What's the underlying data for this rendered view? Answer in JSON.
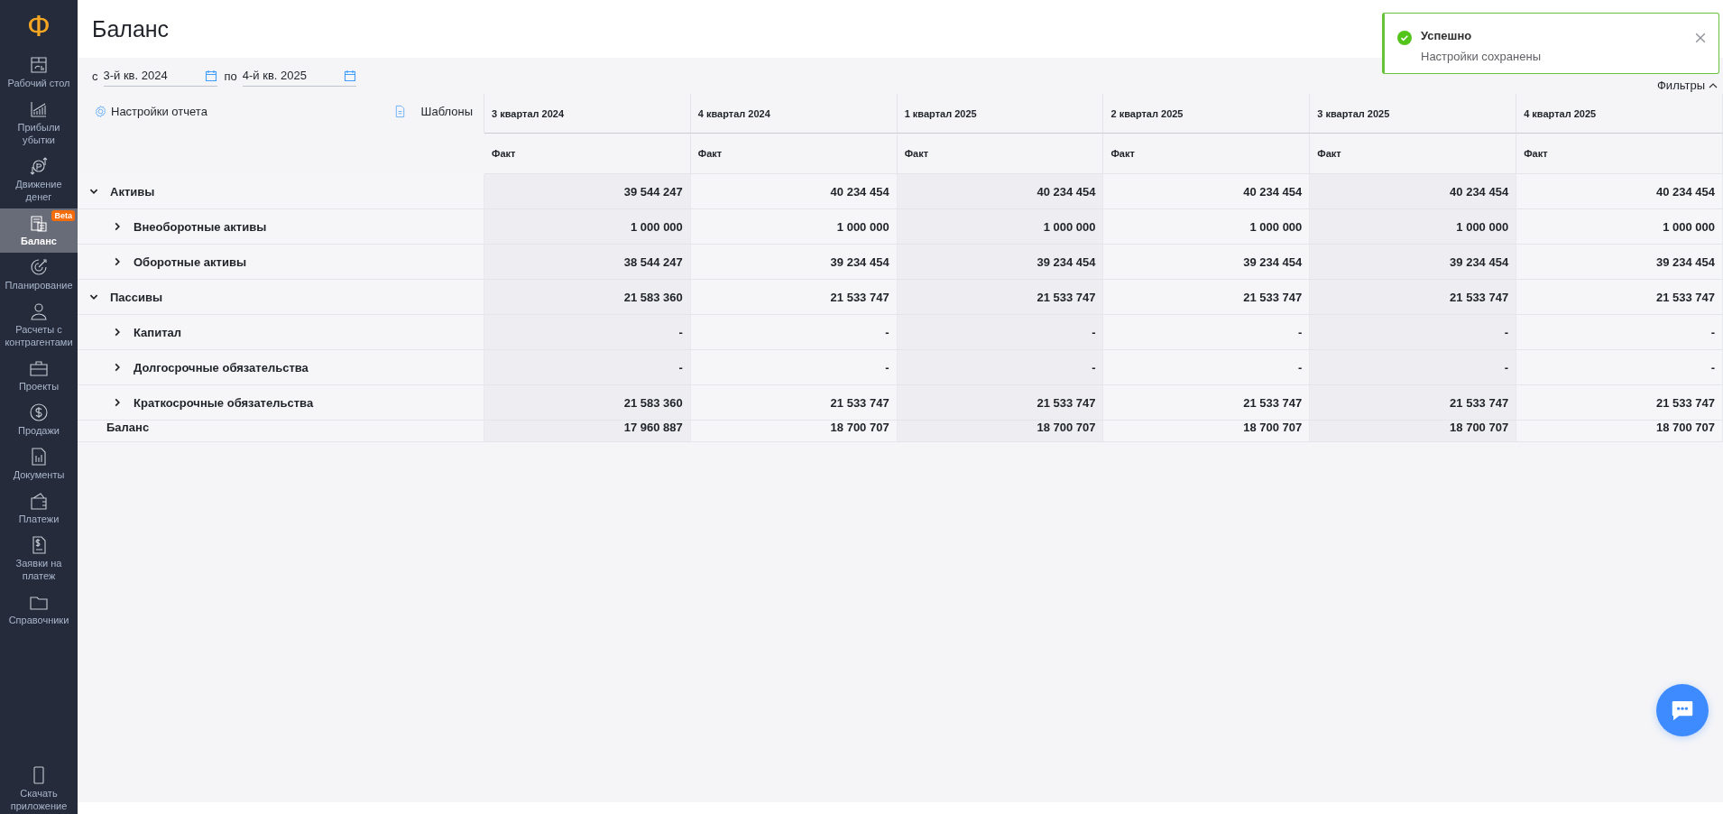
{
  "sidebar": {
    "logo": "Ф",
    "items": [
      {
        "label": "Рабочий стол",
        "selected": false
      },
      {
        "label": "Прибыли\nубытки",
        "selected": false
      },
      {
        "label": "Движение\nденег",
        "selected": false
      },
      {
        "label": "Баланс",
        "selected": true,
        "badge": "Beta"
      },
      {
        "label": "Планирование",
        "selected": false
      },
      {
        "label": "Расчеты с\nконтрагентами",
        "selected": false
      },
      {
        "label": "Проекты",
        "selected": false
      },
      {
        "label": "Продажи",
        "selected": false
      },
      {
        "label": "Документы",
        "selected": false
      },
      {
        "label": "Платежи",
        "selected": false
      },
      {
        "label": "Заявки на\nплатеж",
        "selected": false
      },
      {
        "label": "Справочники",
        "selected": false
      }
    ],
    "download": {
      "label": "Скачать\nприложение"
    }
  },
  "page": {
    "title": "Баланс"
  },
  "period": {
    "from_label": "с",
    "from": "3-й кв. 2024",
    "to_label": "по",
    "to": "4-й кв. 2025"
  },
  "filters": {
    "label": "Фильтры"
  },
  "report_settings": {
    "label": "Настройки отчета"
  },
  "templates": {
    "label": "Шаблоны"
  },
  "table": {
    "columns": [
      {
        "title": "3 квартал 2024",
        "subtitle": "Факт"
      },
      {
        "title": "4 квартал 2024",
        "subtitle": "Факт"
      },
      {
        "title": "1 квартал 2025",
        "subtitle": "Факт"
      },
      {
        "title": "2 квартал 2025",
        "subtitle": "Факт"
      },
      {
        "title": "3 квартал 2025",
        "subtitle": "Факт"
      },
      {
        "title": "4 квартал 2025",
        "subtitle": "Факт"
      }
    ],
    "rows": [
      {
        "label": "Активы",
        "expanded": true,
        "values": [
          "39 544 247",
          "40 234 454",
          "40 234 454",
          "40 234 454",
          "40 234 454",
          "40 234 454"
        ],
        "children": [
          {
            "label": "Внеоборотные активы",
            "expanded": false,
            "values": [
              "1 000 000",
              "1 000 000",
              "1 000 000",
              "1 000 000",
              "1 000 000",
              "1 000 000"
            ]
          },
          {
            "label": "Оборотные активы",
            "expanded": false,
            "values": [
              "38 544 247",
              "39 234 454",
              "39 234 454",
              "39 234 454",
              "39 234 454",
              "39 234 454"
            ]
          }
        ]
      },
      {
        "label": "Пассивы",
        "expanded": true,
        "values": [
          "21 583 360",
          "21 533 747",
          "21 533 747",
          "21 533 747",
          "21 533 747",
          "21 533 747"
        ],
        "children": [
          {
            "label": "Капитал",
            "expanded": false,
            "values": [
              "-",
              "-",
              "-",
              "-",
              "-",
              "-"
            ]
          },
          {
            "label": "Долгосрочные обязательства",
            "expanded": false,
            "values": [
              "-",
              "-",
              "-",
              "-",
              "-",
              "-"
            ]
          },
          {
            "label": "Краткосрочные обязательства",
            "expanded": false,
            "values": [
              "21 583 360",
              "21 533 747",
              "21 533 747",
              "21 533 747",
              "21 533 747",
              "21 533 747"
            ]
          }
        ]
      }
    ],
    "total": {
      "label": "Баланс",
      "values": [
        "17 960 887",
        "18 700 707",
        "18 700 707",
        "18 700 707",
        "18 700 707",
        "18 700 707"
      ]
    }
  },
  "toast": {
    "title": "Успешно",
    "message": "Настройки сохранены"
  }
}
